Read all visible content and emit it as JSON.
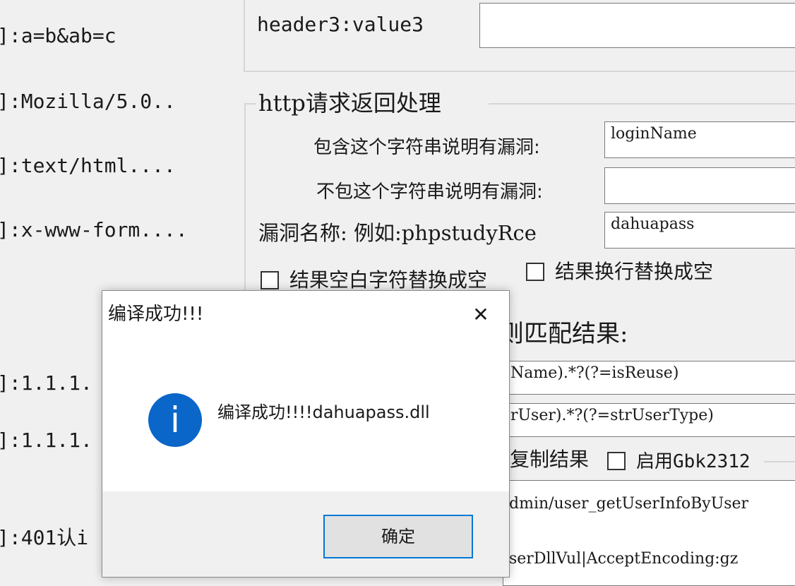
{
  "left_column": {
    "rows": [
      {
        "text": "]:a=b&ab=c"
      },
      {
        "text": "]:Mozilla/5.0.."
      },
      {
        "text": "]:text/html...."
      },
      {
        "text": "]:x-www-form...."
      },
      {
        "text": "]:1.1.1."
      },
      {
        "text": "]:1.1.1."
      },
      {
        "text": "]:401认i"
      }
    ]
  },
  "headers": {
    "header3_label": "header3:value3",
    "header3_value": ""
  },
  "response_group": {
    "title": "http请求返回处理",
    "contains_label": "包含这个字符串说明有漏洞:",
    "contains_value": "loginName",
    "not_contains_label": "不包这个字符串说明有漏洞:",
    "not_contains_value": "",
    "vuln_name_label": "漏洞名称: 例如:phpstudyRce",
    "vuln_name_value": "dahuapass",
    "replace_blank_label": "结果空白字符替换成空",
    "replace_newline_label": "结果换行替换成空"
  },
  "regex_group": {
    "title_fragment": "则匹配结果:",
    "regex1": "Name).*?(?=isReuse)",
    "regex2": "rUser).*?(?=strUserType)",
    "copy_result_label": "复制结果",
    "gbk_label": "启用Gbk2312",
    "request_line1": "dmin/user_getUserInfoByUser",
    "request_line2": "serDllVul|AcceptEncoding:gz"
  },
  "dialog": {
    "title": "编译成功!!!",
    "message": "编译成功!!!!dahuapass.dll",
    "ok_label": "确定",
    "close_glyph": "✕",
    "info_glyph": "i",
    "icon": "info-icon"
  },
  "colors": {
    "accent": "#0078d7",
    "info_icon": "#0a66c8"
  }
}
